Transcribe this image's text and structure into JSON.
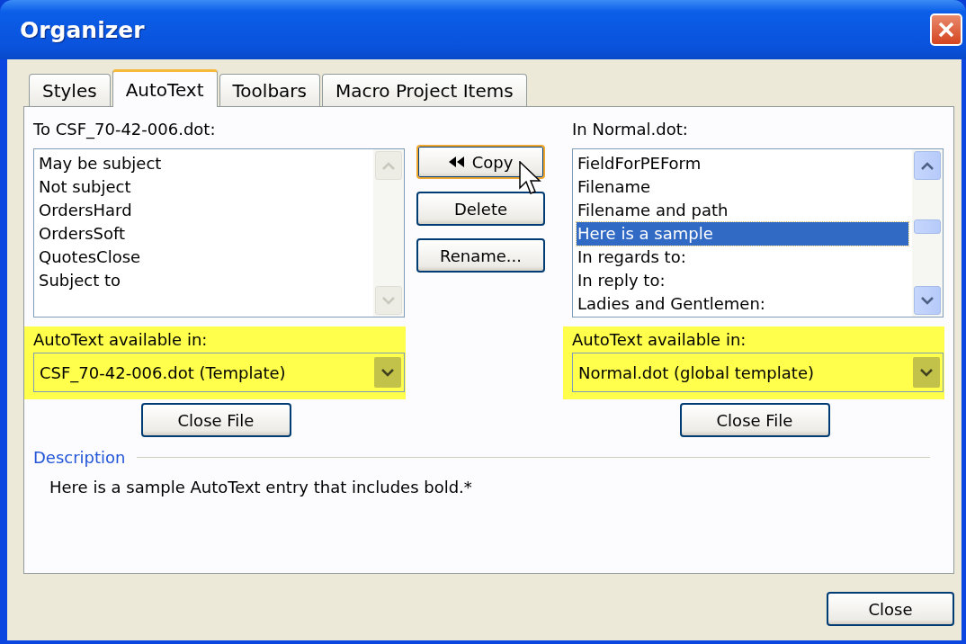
{
  "window": {
    "title": "Organizer"
  },
  "tabs": [
    {
      "label": "Styles",
      "selected": false
    },
    {
      "label": "AutoText",
      "selected": true
    },
    {
      "label": "Toolbars",
      "selected": false
    },
    {
      "label": "Macro Project Items",
      "selected": false
    }
  ],
  "left": {
    "list_label": "To CSF_70-42-006.dot:",
    "scrollable": false,
    "items": [
      {
        "label": "May be subject",
        "selected": false
      },
      {
        "label": "Not subject",
        "selected": false
      },
      {
        "label": "OrdersHard",
        "selected": false
      },
      {
        "label": "OrdersSoft",
        "selected": false
      },
      {
        "label": "QuotesClose",
        "selected": false
      },
      {
        "label": "Subject to",
        "selected": false
      }
    ],
    "highlighted": true,
    "available_label": "AutoText available in:",
    "available_value": "CSF_70-42-006.dot (Template)",
    "close_file": "Close File"
  },
  "middle_buttons": [
    {
      "label": "Copy",
      "arrows": true,
      "default": true
    },
    {
      "label": "Delete",
      "arrows": false,
      "default": false
    },
    {
      "label": "Rename...",
      "arrows": false,
      "default": false
    }
  ],
  "right": {
    "list_label": "In Normal.dot:",
    "scrollable": true,
    "items": [
      {
        "label": "FieldForPEForm",
        "selected": false
      },
      {
        "label": "Filename",
        "selected": false
      },
      {
        "label": "Filename and path",
        "selected": false
      },
      {
        "label": "Here is a sample",
        "selected": true
      },
      {
        "label": "In regards to:",
        "selected": false
      },
      {
        "label": "In reply to:",
        "selected": false
      },
      {
        "label": "Ladies and Gentlemen:",
        "selected": false
      }
    ],
    "highlighted": true,
    "available_label": "AutoText available in:",
    "available_value": "Normal.dot (global template)",
    "close_file": "Close File"
  },
  "description": {
    "label": "Description",
    "text": "Here is a sample AutoText entry that includes bold.*"
  },
  "close_button": "Close"
}
